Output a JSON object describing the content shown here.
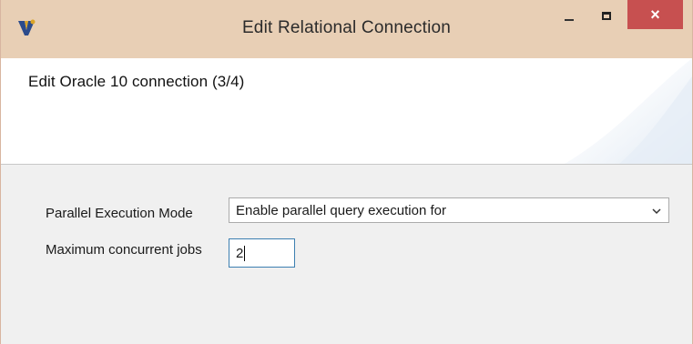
{
  "window": {
    "title": "Edit Relational Connection",
    "close_label": "×"
  },
  "header": {
    "title": "Edit Oracle 10 connection (3/4)"
  },
  "form": {
    "parallel_mode_label": "Parallel Execution Mode",
    "parallel_mode_value": "Enable parallel query execution for",
    "max_jobs_label": "Maximum concurrent jobs",
    "max_jobs_value": "2"
  },
  "colors": {
    "titlebar": "#e8cfb5",
    "close_button": "#c75050",
    "input_focus_border": "#3c7fb1"
  }
}
